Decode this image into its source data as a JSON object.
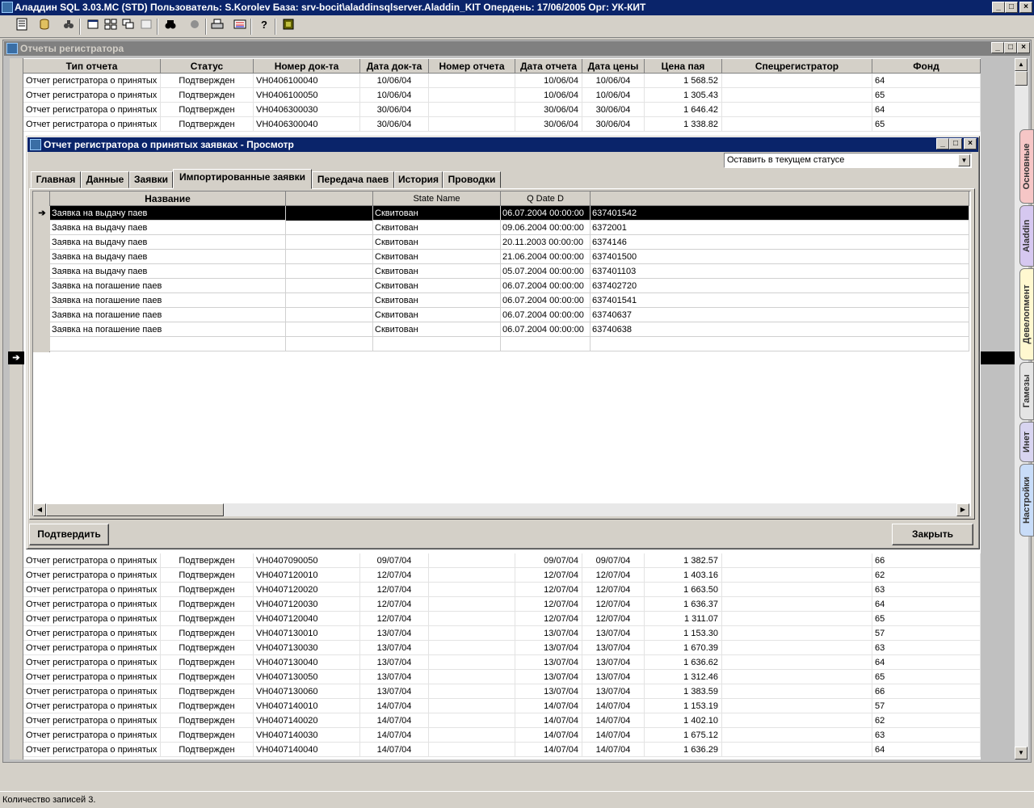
{
  "app": {
    "title": "Аладдин SQL 3.03.MC (STD)  Пользователь: S.Korolev База: srv-bocit\\aladdinsqlserver.Aladdin_KIT Опердень: 17/06/2005 Орг: УК-КИТ",
    "min_glyph": "_",
    "max_glyph": "□",
    "close_glyph": "×"
  },
  "toolbar": {
    "icons": [
      "table-icon",
      "db-icon",
      "binoculars-settings-icon",
      "window-icon",
      "tile-icon",
      "cascade-icon",
      "window2-icon",
      "search-icon",
      "stop-icon",
      "print-icon",
      "export-icon",
      "help-icon",
      "exit-icon"
    ]
  },
  "mdi": {
    "title": "Отчеты регистратора",
    "columns": [
      "Тип отчета",
      "Статус",
      "Номер док-та",
      "Дата док-та",
      "Номер отчета",
      "Дата отчета",
      "Дата цены",
      "Цена пая",
      "Спецрегистратор",
      "Фонд"
    ],
    "rows_top": [
      [
        "Отчет регистратора о принятых",
        "Подтвержден",
        "VH0406100040",
        "10/06/04",
        "",
        "10/06/04",
        "10/06/04",
        "1 568.52",
        "",
        "64"
      ],
      [
        "Отчет регистратора о принятых",
        "Подтвержден",
        "VH0406100050",
        "10/06/04",
        "",
        "10/06/04",
        "10/06/04",
        "1 305.43",
        "",
        "65"
      ],
      [
        "Отчет регистратора о принятых",
        "Подтвержден",
        "VH0406300030",
        "30/06/04",
        "",
        "30/06/04",
        "30/06/04",
        "1 646.42",
        "",
        "64"
      ],
      [
        "Отчет регистратора о принятых",
        "Подтвержден",
        "VH0406300040",
        "30/06/04",
        "",
        "30/06/04",
        "30/06/04",
        "1 338.82",
        "",
        "65"
      ]
    ],
    "rows_bottom": [
      [
        "Отчет регистратора о принятых",
        "Подтвержден",
        "VH0407090050",
        "09/07/04",
        "",
        "09/07/04",
        "09/07/04",
        "1 382.57",
        "",
        "66"
      ],
      [
        "Отчет регистратора о принятых",
        "Подтвержден",
        "VH0407120010",
        "12/07/04",
        "",
        "12/07/04",
        "12/07/04",
        "1 403.16",
        "",
        "62"
      ],
      [
        "Отчет регистратора о принятых",
        "Подтвержден",
        "VH0407120020",
        "12/07/04",
        "",
        "12/07/04",
        "12/07/04",
        "1 663.50",
        "",
        "63"
      ],
      [
        "Отчет регистратора о принятых",
        "Подтвержден",
        "VH0407120030",
        "12/07/04",
        "",
        "12/07/04",
        "12/07/04",
        "1 636.37",
        "",
        "64"
      ],
      [
        "Отчет регистратора о принятых",
        "Подтвержден",
        "VH0407120040",
        "12/07/04",
        "",
        "12/07/04",
        "12/07/04",
        "1 311.07",
        "",
        "65"
      ],
      [
        "Отчет регистратора о принятых",
        "Подтвержден",
        "VH0407130010",
        "13/07/04",
        "",
        "13/07/04",
        "13/07/04",
        "1 153.30",
        "",
        "57"
      ],
      [
        "Отчет регистратора о принятых",
        "Подтвержден",
        "VH0407130030",
        "13/07/04",
        "",
        "13/07/04",
        "13/07/04",
        "1 670.39",
        "",
        "63"
      ],
      [
        "Отчет регистратора о принятых",
        "Подтвержден",
        "VH0407130040",
        "13/07/04",
        "",
        "13/07/04",
        "13/07/04",
        "1 636.62",
        "",
        "64"
      ],
      [
        "Отчет регистратора о принятых",
        "Подтвержден",
        "VH0407130050",
        "13/07/04",
        "",
        "13/07/04",
        "13/07/04",
        "1 312.46",
        "",
        "65"
      ],
      [
        "Отчет регистратора о принятых",
        "Подтвержден",
        "VH0407130060",
        "13/07/04",
        "",
        "13/07/04",
        "13/07/04",
        "1 383.59",
        "",
        "66"
      ],
      [
        "Отчет регистратора о принятых",
        "Подтвержден",
        "VH0407140010",
        "14/07/04",
        "",
        "14/07/04",
        "14/07/04",
        "1 153.19",
        "",
        "57"
      ],
      [
        "Отчет регистратора о принятых",
        "Подтвержден",
        "VH0407140020",
        "14/07/04",
        "",
        "14/07/04",
        "14/07/04",
        "1 402.10",
        "",
        "62"
      ],
      [
        "Отчет регистратора о принятых",
        "Подтвержден",
        "VH0407140030",
        "14/07/04",
        "",
        "14/07/04",
        "14/07/04",
        "1 675.12",
        "",
        "63"
      ],
      [
        "Отчет регистратора о принятых",
        "Подтвержден",
        "VH0407140040",
        "14/07/04",
        "",
        "14/07/04",
        "14/07/04",
        "1 636.29",
        "",
        "64"
      ]
    ]
  },
  "side_tabs": [
    "Основные",
    "Aladdin",
    "Девелопмент",
    "Гамезы",
    "Инет",
    "Настройки"
  ],
  "dialog": {
    "title": "Отчет регистратора о принятых заявках - Просмотр",
    "status_select": "Оставить в текущем статусе",
    "tabs": [
      "Главная",
      "Данные",
      "Заявки",
      "Импортированные заявки",
      "Передача паев",
      "История",
      "Проводки"
    ],
    "active_tab": 3,
    "grid_columns": [
      "Название",
      "",
      "State Name",
      "Q Date D",
      ""
    ],
    "grid_rows": [
      [
        "Заявка на выдачу паев",
        "",
        "Сквитован",
        "06.07.2004 00:00:00",
        "637401542"
      ],
      [
        "Заявка на выдачу паев",
        "",
        "Сквитован",
        "09.06.2004 00:00:00",
        "6372001"
      ],
      [
        "Заявка на выдачу паев",
        "",
        "Сквитован",
        "20.11.2003 00:00:00",
        "6374146"
      ],
      [
        "Заявка на выдачу паев",
        "",
        "Сквитован",
        "21.06.2004 00:00:00",
        "637401500"
      ],
      [
        "Заявка на выдачу паев",
        "",
        "Сквитован",
        "05.07.2004 00:00:00",
        "637401103"
      ],
      [
        "Заявка на погашение паев",
        "",
        "Сквитован",
        "06.07.2004 00:00:00",
        "637402720"
      ],
      [
        "Заявка на погашение паев",
        "",
        "Сквитован",
        "06.07.2004 00:00:00",
        "637401541"
      ],
      [
        "Заявка на погашение паев",
        "",
        "Сквитован",
        "06.07.2004 00:00:00",
        "63740637"
      ],
      [
        "Заявка на погашение паев",
        "",
        "Сквитован",
        "06.07.2004 00:00:00",
        "63740638"
      ]
    ],
    "confirm_button": "Подтвердить",
    "close_button": "Закрыть"
  },
  "statusbar": {
    "text": "Количество записей 3."
  },
  "colors": {
    "title_active": "#0a246a",
    "title_inactive": "#808080",
    "face": "#d4d0c8",
    "selection": "#000000"
  }
}
